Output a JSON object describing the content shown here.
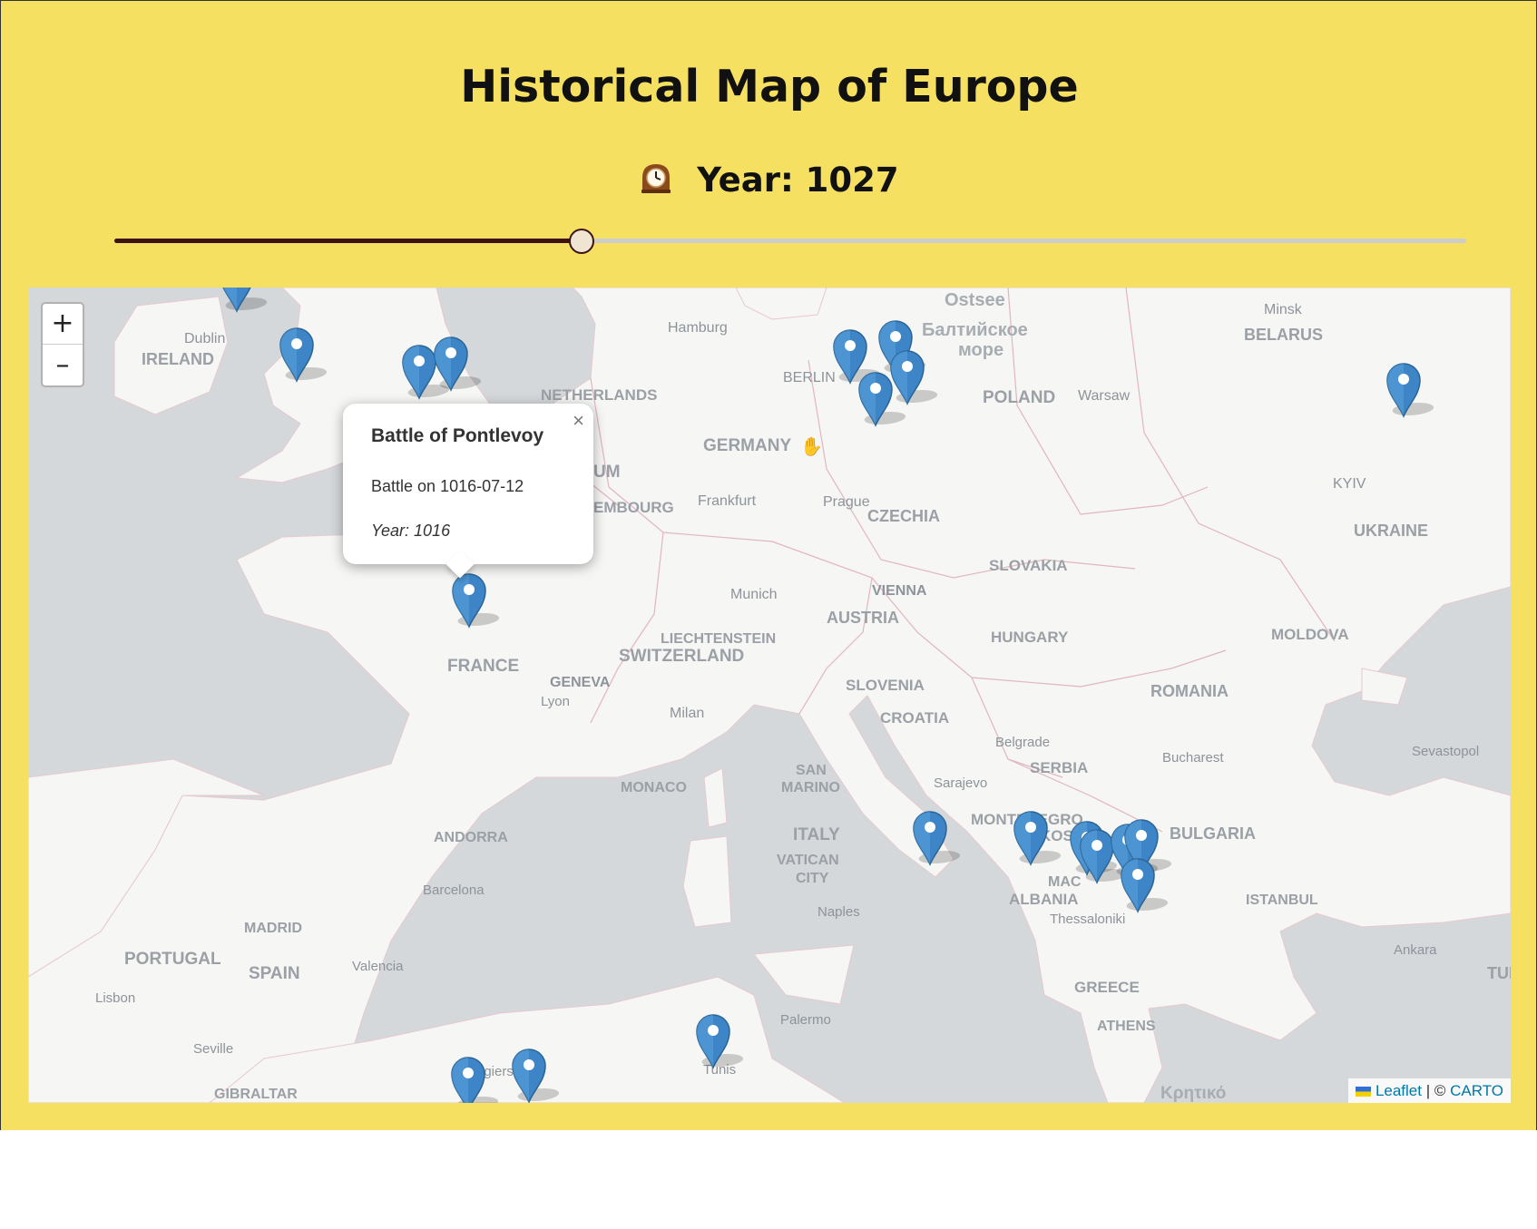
{
  "page": {
    "title": "Historical Map of Europe"
  },
  "timeline": {
    "clock_icon": "mantelpiece-clock-icon",
    "year_label": "Year: 1027",
    "slider_fraction": 0.345,
    "colors": {
      "fill": "#3c1414",
      "track": "#cccccc",
      "background": "#f5e062"
    }
  },
  "map": {
    "zoom_in_label": "+",
    "zoom_out_label": "–",
    "place_labels": [
      "Ostsee",
      "Балтийское",
      "море",
      "Minsk",
      "BELARUS",
      "Hamburg",
      "Dublin",
      "IRELAND",
      "BERLIN",
      "POLAND",
      "Warsaw",
      "NETHERLANDS",
      "GERMANY",
      "UM",
      "EMBOURG",
      "Frankfurt",
      "Prague",
      "CZECHIA",
      "KYIV",
      "UKRAINE",
      "SLOVAKIA",
      "VIENNA",
      "Munich",
      "AUSTRIA",
      "HUNGARY",
      "MOLDOVA",
      "LIECHTENSTEIN",
      "SWITZERLAND",
      "FRANCE",
      "GENEVA",
      "Lyon",
      "SLOVENIA",
      "ROMANIA",
      "Milan",
      "CROATIA",
      "Belgrade",
      "Bucharest",
      "Sevastopol",
      "SAN",
      "MARINO",
      "SERBIA",
      "MONACO",
      "Sarajevo",
      "MONTENEGRO",
      "KOSOVO",
      "BULGARIA",
      "ANDORRA",
      "ITALY",
      "VATICAN",
      "CITY",
      "MAC",
      "ALBANIA",
      "ISTANBUL",
      "Thessaloniki",
      "Barcelona",
      "Naples",
      "MADRID",
      "PORTUGAL",
      "SPAIN",
      "Valencia",
      "Ankara",
      "TUI",
      "Lisbon",
      "GREECE",
      "Palermo",
      "ATHENS",
      "Seville",
      "Algiers",
      "Tunis",
      "GIBRALTAR",
      "Κρητικό"
    ],
    "attribution": {
      "leaflet": "Leaflet",
      "separator": " | © ",
      "carto": "CARTO"
    },
    "popup": {
      "title": "Battle of Pontlevoy",
      "line": "Battle on 1016-07-12",
      "year": "Year: 1016",
      "close": "×"
    }
  }
}
